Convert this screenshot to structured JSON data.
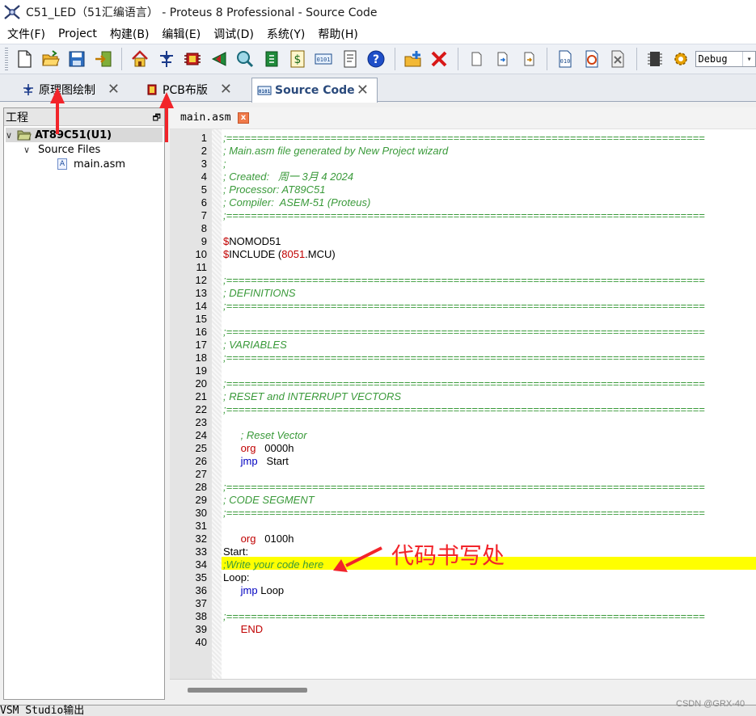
{
  "window": {
    "title": "C51_LED（51汇编语言） - Proteus 8 Professional - Source Code",
    "app_icon": "proteus-logo-icon"
  },
  "menu": [
    {
      "label": "文件(F)"
    },
    {
      "label": "Project"
    },
    {
      "label": "构建(B)"
    },
    {
      "label": "编辑(E)"
    },
    {
      "label": "调试(D)"
    },
    {
      "label": "系统(Y)"
    },
    {
      "label": "帮助(H)"
    }
  ],
  "toolbar": {
    "buttons": [
      {
        "name": "new-file-icon"
      },
      {
        "name": "open-folder-icon"
      },
      {
        "name": "save-icon"
      },
      {
        "name": "close-project-icon"
      },
      {
        "name": "home-icon"
      },
      {
        "name": "schematic-icon"
      },
      {
        "name": "pcb-icon"
      },
      {
        "name": "gerber-icon"
      },
      {
        "name": "3d-view-icon"
      },
      {
        "name": "bom-icon"
      },
      {
        "name": "cost-icon"
      },
      {
        "name": "source-code-icon"
      },
      {
        "name": "notes-icon"
      },
      {
        "name": "help-icon"
      },
      {
        "name": "add-file-icon"
      },
      {
        "name": "remove-icon"
      },
      {
        "name": "blank-page-icon"
      },
      {
        "name": "import-icon"
      },
      {
        "name": "export-icon"
      },
      {
        "name": "compile-icon"
      },
      {
        "name": "rebuild-icon"
      },
      {
        "name": "clean-icon"
      },
      {
        "name": "chip-icon"
      },
      {
        "name": "settings-gear-icon"
      }
    ],
    "config_value": "Debug"
  },
  "tabs": [
    {
      "label": "原理图绘制",
      "close": "✕"
    },
    {
      "label": "PCB布版",
      "close": "✕"
    },
    {
      "label": "Source Code",
      "close": "✕"
    }
  ],
  "project_pane": {
    "title": "工程",
    "pin_glyph": "🗗",
    "tree": {
      "project": "AT89C51(U1)",
      "folder": "Source Files",
      "file": "main.asm",
      "file_icon_letter": "A"
    }
  },
  "editor": {
    "file_tab": "main.asm",
    "file_tab_close": "x",
    "lines": [
      {
        "n": "1",
        "segs": [
          {
            "c": "c-comment",
            "t": ";=============================================================================="
          }
        ]
      },
      {
        "n": "2",
        "segs": [
          {
            "c": "c-comment",
            "t": "; Main.asm file generated by New Project wizard"
          }
        ]
      },
      {
        "n": "3",
        "segs": [
          {
            "c": "c-comment",
            "t": ";"
          }
        ]
      },
      {
        "n": "4",
        "segs": [
          {
            "c": "c-comment",
            "t": "; Created:   周一 3月 4 2024"
          }
        ]
      },
      {
        "n": "5",
        "segs": [
          {
            "c": "c-comment",
            "t": "; Processor: AT89C51"
          }
        ]
      },
      {
        "n": "6",
        "segs": [
          {
            "c": "c-comment",
            "t": "; Compiler:  ASEM-51 (Proteus)"
          }
        ]
      },
      {
        "n": "7",
        "segs": [
          {
            "c": "c-comment",
            "t": ";=============================================================================="
          }
        ]
      },
      {
        "n": "8",
        "segs": []
      },
      {
        "n": "9",
        "segs": [
          {
            "c": "c-red",
            "t": "$"
          },
          {
            "c": "c-plain",
            "t": "NOMOD51"
          }
        ]
      },
      {
        "n": "10",
        "segs": [
          {
            "c": "c-red",
            "t": "$"
          },
          {
            "c": "c-plain",
            "t": "INCLUDE ("
          },
          {
            "c": "c-num",
            "t": "8051"
          },
          {
            "c": "c-plain",
            "t": ".MCU)"
          }
        ]
      },
      {
        "n": "11",
        "segs": []
      },
      {
        "n": "12",
        "segs": [
          {
            "c": "c-comment",
            "t": ";=============================================================================="
          }
        ]
      },
      {
        "n": "13",
        "segs": [
          {
            "c": "c-comment",
            "t": "; DEFINITIONS"
          }
        ]
      },
      {
        "n": "14",
        "segs": [
          {
            "c": "c-comment",
            "t": ";=============================================================================="
          }
        ]
      },
      {
        "n": "15",
        "segs": []
      },
      {
        "n": "16",
        "segs": [
          {
            "c": "c-comment",
            "t": ";=============================================================================="
          }
        ]
      },
      {
        "n": "17",
        "segs": [
          {
            "c": "c-comment",
            "t": "; VARIABLES"
          }
        ]
      },
      {
        "n": "18",
        "segs": [
          {
            "c": "c-comment",
            "t": ";=============================================================================="
          }
        ]
      },
      {
        "n": "19",
        "segs": []
      },
      {
        "n": "20",
        "segs": [
          {
            "c": "c-comment",
            "t": ";=============================================================================="
          }
        ]
      },
      {
        "n": "21",
        "segs": [
          {
            "c": "c-comment",
            "t": "; RESET and INTERRUPT VECTORS"
          }
        ]
      },
      {
        "n": "22",
        "segs": [
          {
            "c": "c-comment",
            "t": ";=============================================================================="
          }
        ]
      },
      {
        "n": "23",
        "segs": []
      },
      {
        "n": "24",
        "segs": [
          {
            "c": "c-comment",
            "t": "      ; Reset Vector"
          }
        ]
      },
      {
        "n": "25",
        "segs": [
          {
            "c": "c-plain",
            "t": "      "
          },
          {
            "c": "c-red",
            "t": "org"
          },
          {
            "c": "c-plain",
            "t": "   0000h"
          }
        ]
      },
      {
        "n": "26",
        "segs": [
          {
            "c": "c-plain",
            "t": "      "
          },
          {
            "c": "c-kw",
            "t": "jmp"
          },
          {
            "c": "c-plain",
            "t": "   Start"
          }
        ]
      },
      {
        "n": "27",
        "segs": []
      },
      {
        "n": "28",
        "segs": [
          {
            "c": "c-comment",
            "t": ";=============================================================================="
          }
        ]
      },
      {
        "n": "29",
        "segs": [
          {
            "c": "c-comment",
            "t": "; CODE SEGMENT"
          }
        ]
      },
      {
        "n": "30",
        "segs": [
          {
            "c": "c-comment",
            "t": ";=============================================================================="
          }
        ]
      },
      {
        "n": "31",
        "segs": []
      },
      {
        "n": "32",
        "segs": [
          {
            "c": "c-plain",
            "t": "      "
          },
          {
            "c": "c-red",
            "t": "org"
          },
          {
            "c": "c-plain",
            "t": "   0100h"
          }
        ]
      },
      {
        "n": "33",
        "segs": [
          {
            "c": "c-plain",
            "t": "Start:"
          }
        ]
      },
      {
        "n": "34",
        "segs": [
          {
            "c": "c-comment",
            "t": ";Write your code here"
          }
        ]
      },
      {
        "n": "35",
        "segs": [
          {
            "c": "c-plain",
            "t": "Loop:"
          }
        ]
      },
      {
        "n": "36",
        "segs": [
          {
            "c": "c-plain",
            "t": "      "
          },
          {
            "c": "c-kw",
            "t": "jmp"
          },
          {
            "c": "c-plain",
            "t": " Loop"
          }
        ]
      },
      {
        "n": "37",
        "segs": []
      },
      {
        "n": "38",
        "segs": [
          {
            "c": "c-comment",
            "t": ";=============================================================================="
          }
        ]
      },
      {
        "n": "39",
        "segs": [
          {
            "c": "c-plain",
            "t": "      "
          },
          {
            "c": "c-red",
            "t": "END"
          }
        ]
      },
      {
        "n": "40",
        "segs": []
      }
    ],
    "highlight_line": "34"
  },
  "annotation": {
    "text": "代码书写处",
    "color": "#f2242a"
  },
  "bottom_panel": {
    "label": "VSM Studio输出"
  },
  "watermark": "CSDN @GRX-40"
}
